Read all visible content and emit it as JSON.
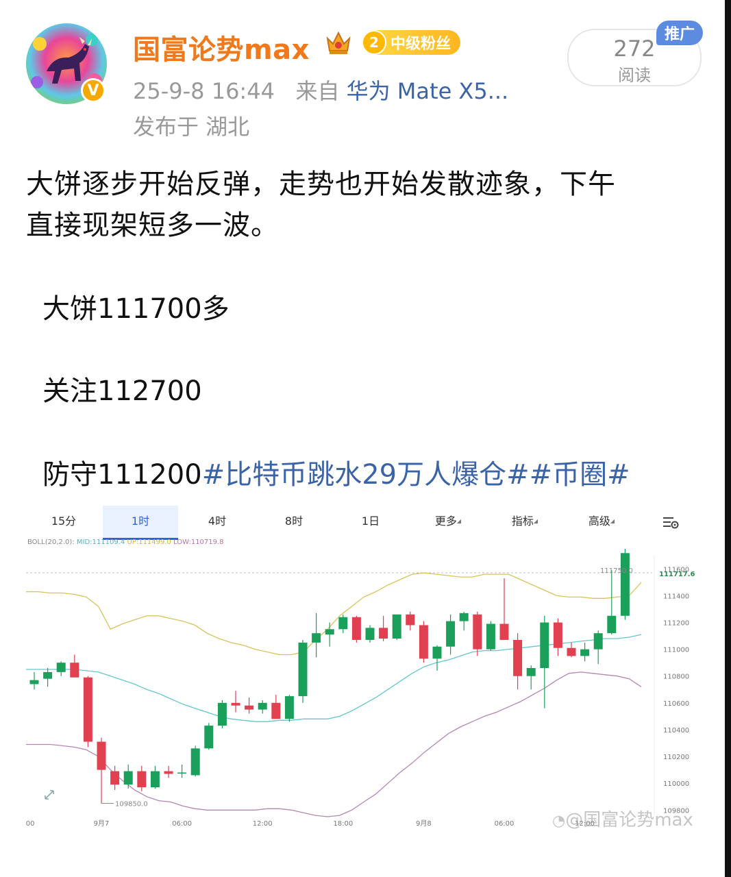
{
  "header": {
    "username": "国富论势max",
    "fan_level": "2",
    "fan_badge": "中级粉丝",
    "timestamp": "25-9-8 16:44",
    "source_prefix": "来自",
    "source": "华为 Mate X5...",
    "location": "发布于 湖北",
    "read_count": "272",
    "read_label": "阅读",
    "promo_label": "推广"
  },
  "post": {
    "line1": "大饼逐步开始反弹，走势也开始发散迹象，下午",
    "line2": "直接现架短多一波。",
    "entry": "大饼111700多",
    "watch": "关注112700",
    "defend": "防守111200",
    "tag1": "#比特币跳水29万人爆仓#",
    "tag2": "#币圈#"
  },
  "toolbar": {
    "items": [
      "15分",
      "1时",
      "4时",
      "8时",
      "1日",
      "更多",
      "指标",
      "高级"
    ],
    "active": "1时"
  },
  "indicator": {
    "name": "BOLL(20,2.0):",
    "mid": "MID:111109.4",
    "up": "UP:111499.0",
    "low": "LOW:110719.8"
  },
  "watermark": "@国富论势max",
  "chart_data": {
    "type": "candlestick",
    "interval": "1h",
    "x_tick_labels": [
      "00",
      "9月7",
      "06:00",
      "12:00",
      "18:00",
      "9月8",
      "06:00",
      "12:00"
    ],
    "y_tick_labels": [
      "111600",
      "111400",
      "111200",
      "111000",
      "110800",
      "110600",
      "110400",
      "110200",
      "110000",
      "109800"
    ],
    "ylim": [
      109740,
      111750
    ],
    "last_price": "111717.6",
    "high_marker": "111750.0",
    "low_marker": "109850.0",
    "grid": false,
    "candles": [
      {
        "o": 110740,
        "h": 110830,
        "l": 110700,
        "c": 110770
      },
      {
        "o": 110780,
        "h": 110860,
        "l": 110720,
        "c": 110830
      },
      {
        "o": 110830,
        "h": 110910,
        "l": 110800,
        "c": 110900
      },
      {
        "o": 110900,
        "h": 110960,
        "l": 110830,
        "c": 110790
      },
      {
        "o": 110790,
        "h": 110800,
        "l": 110270,
        "c": 110310
      },
      {
        "o": 110310,
        "h": 110340,
        "l": 109850,
        "c": 110100
      },
      {
        "o": 110090,
        "h": 110130,
        "l": 109950,
        "c": 109990
      },
      {
        "o": 109990,
        "h": 110140,
        "l": 109960,
        "c": 110090
      },
      {
        "o": 110090,
        "h": 110130,
        "l": 109940,
        "c": 109970
      },
      {
        "o": 109970,
        "h": 110130,
        "l": 109960,
        "c": 110090
      },
      {
        "o": 110090,
        "h": 110130,
        "l": 110040,
        "c": 110070
      },
      {
        "o": 110080,
        "h": 110140,
        "l": 110040,
        "c": 110080
      },
      {
        "o": 110060,
        "h": 110280,
        "l": 110050,
        "c": 110260
      },
      {
        "o": 110260,
        "h": 110450,
        "l": 110250,
        "c": 110430
      },
      {
        "o": 110430,
        "h": 110620,
        "l": 110410,
        "c": 110600
      },
      {
        "o": 110600,
        "h": 110690,
        "l": 110530,
        "c": 110580
      },
      {
        "o": 110580,
        "h": 110640,
        "l": 110520,
        "c": 110550
      },
      {
        "o": 110550,
        "h": 110620,
        "l": 110520,
        "c": 110600
      },
      {
        "o": 110600,
        "h": 110660,
        "l": 110480,
        "c": 110480
      },
      {
        "o": 110480,
        "h": 110660,
        "l": 110460,
        "c": 110650
      },
      {
        "o": 110650,
        "h": 111070,
        "l": 110600,
        "c": 111050
      },
      {
        "o": 111050,
        "h": 111270,
        "l": 110940,
        "c": 111120
      },
      {
        "o": 111110,
        "h": 111200,
        "l": 111020,
        "c": 111150
      },
      {
        "o": 111150,
        "h": 111260,
        "l": 111120,
        "c": 111240
      },
      {
        "o": 111240,
        "h": 111250,
        "l": 111050,
        "c": 111070
      },
      {
        "o": 111070,
        "h": 111180,
        "l": 111050,
        "c": 111160
      },
      {
        "o": 111160,
        "h": 111250,
        "l": 111060,
        "c": 111080
      },
      {
        "o": 111080,
        "h": 111260,
        "l": 111070,
        "c": 111260
      },
      {
        "o": 111260,
        "h": 111280,
        "l": 111140,
        "c": 111180
      },
      {
        "o": 111180,
        "h": 111210,
        "l": 110900,
        "c": 110930
      },
      {
        "o": 110930,
        "h": 111030,
        "l": 110840,
        "c": 111020
      },
      {
        "o": 111020,
        "h": 111260,
        "l": 110960,
        "c": 111210
      },
      {
        "o": 111210,
        "h": 111280,
        "l": 111140,
        "c": 111270
      },
      {
        "o": 111260,
        "h": 111280,
        "l": 110950,
        "c": 111000
      },
      {
        "o": 111000,
        "h": 111210,
        "l": 110990,
        "c": 111190
      },
      {
        "o": 111190,
        "h": 111530,
        "l": 111090,
        "c": 111070
      },
      {
        "o": 111070,
        "h": 111120,
        "l": 110700,
        "c": 110800
      },
      {
        "o": 110800,
        "h": 110880,
        "l": 110700,
        "c": 110860
      },
      {
        "o": 110860,
        "h": 111250,
        "l": 110560,
        "c": 111200
      },
      {
        "o": 111200,
        "h": 111230,
        "l": 110950,
        "c": 111010
      },
      {
        "o": 111010,
        "h": 111050,
        "l": 110940,
        "c": 110950
      },
      {
        "o": 110950,
        "h": 111050,
        "l": 110910,
        "c": 111000
      },
      {
        "o": 111000,
        "h": 111140,
        "l": 110890,
        "c": 111120
      },
      {
        "o": 111120,
        "h": 111590,
        "l": 111110,
        "c": 111250
      },
      {
        "o": 111250,
        "h": 111750,
        "l": 111220,
        "c": 111718
      }
    ],
    "boll": {
      "up": [
        111430,
        111430,
        111420,
        111420,
        111410,
        111390,
        111320,
        111150,
        111190,
        111220,
        111250,
        111250,
        111230,
        111210,
        111180,
        111120,
        111080,
        111050,
        111030,
        111000,
        110980,
        110960,
        110960,
        110980,
        111070,
        111150,
        111250,
        111320,
        111390,
        111430,
        111480,
        111520,
        111560,
        111570,
        111560,
        111550,
        111540,
        111540,
        111560,
        111560,
        111560,
        111520,
        111480,
        111440,
        111400,
        111390,
        111390,
        111380,
        111380,
        111390,
        111400,
        111500
      ],
      "mid": [
        110850,
        110850,
        110850,
        110850,
        110850,
        110840,
        110830,
        110800,
        110770,
        110740,
        110700,
        110670,
        110630,
        110590,
        110560,
        110530,
        110500,
        110480,
        110470,
        110460,
        110460,
        110470,
        110470,
        110480,
        110480,
        110480,
        110500,
        110540,
        110590,
        110640,
        110700,
        110760,
        110820,
        110870,
        110900,
        110920,
        110950,
        110980,
        110990,
        110990,
        111000,
        111010,
        111020,
        111030,
        111040,
        111050,
        111060,
        111070,
        111080,
        111080,
        111090,
        111110
      ],
      "low": [
        110290,
        110290,
        110290,
        110280,
        110270,
        110250,
        110200,
        110100,
        110020,
        109950,
        109900,
        109870,
        109860,
        109830,
        109810,
        109800,
        109800,
        109800,
        109800,
        109800,
        109810,
        109810,
        109800,
        109780,
        109760,
        109750,
        109760,
        109800,
        109860,
        109920,
        110000,
        110080,
        110150,
        110230,
        110300,
        110370,
        110420,
        110460,
        110500,
        110530,
        110570,
        110610,
        110660,
        110710,
        110770,
        110820,
        110830,
        110820,
        110810,
        110800,
        110780,
        110720
      ]
    }
  }
}
